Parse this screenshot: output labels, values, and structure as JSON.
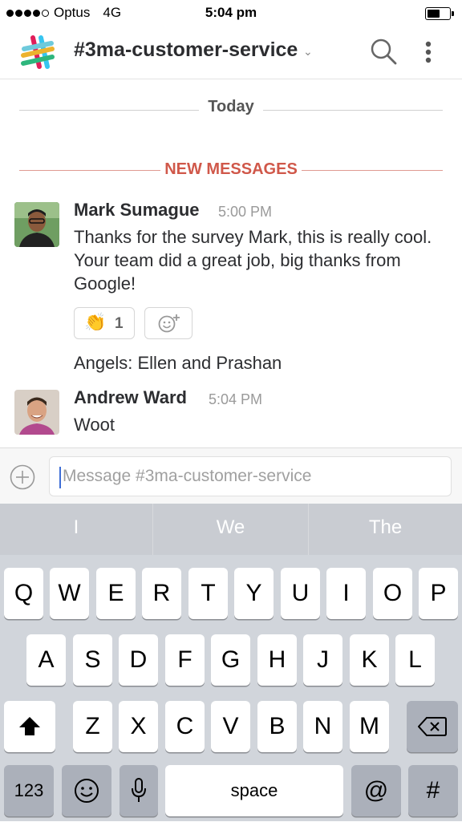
{
  "status_bar": {
    "carrier": "Optus",
    "network": "4G",
    "time": "5:04 pm"
  },
  "header": {
    "channel_name": "#3ma-customer-service",
    "icons": [
      "slack-logo-icon",
      "chevron-down-icon",
      "search-icon",
      "more-vertical-icon"
    ]
  },
  "dividers": {
    "today": "Today",
    "new_messages": "NEW MESSAGES"
  },
  "messages": [
    {
      "author": "Mark Sumague",
      "time": "5:00 PM",
      "text": "Thanks for the survey Mark, this is really cool. Your team did a great job, big thanks from Google!",
      "reaction": {
        "emoji": "👏",
        "count": "1"
      },
      "followup": "Angels: Ellen and Prashan"
    },
    {
      "author": "Andrew Ward",
      "time": "5:04 PM",
      "text": "Woot"
    }
  ],
  "composer": {
    "placeholder": "Message #3ma-customer-service"
  },
  "keyboard": {
    "predictions": [
      "I",
      "We",
      "The"
    ],
    "row1": [
      "Q",
      "W",
      "E",
      "R",
      "T",
      "Y",
      "U",
      "I",
      "O",
      "P"
    ],
    "row2": [
      "A",
      "S",
      "D",
      "F",
      "G",
      "H",
      "J",
      "K",
      "L"
    ],
    "row3": [
      "Z",
      "X",
      "C",
      "V",
      "B",
      "N",
      "M"
    ],
    "numbers": "123",
    "space": "space",
    "at": "@",
    "hash": "#"
  },
  "colors": {
    "new_messages": "#d0584a",
    "caret": "#3e6ed6",
    "keyboard_bg": "#d1d5db"
  }
}
